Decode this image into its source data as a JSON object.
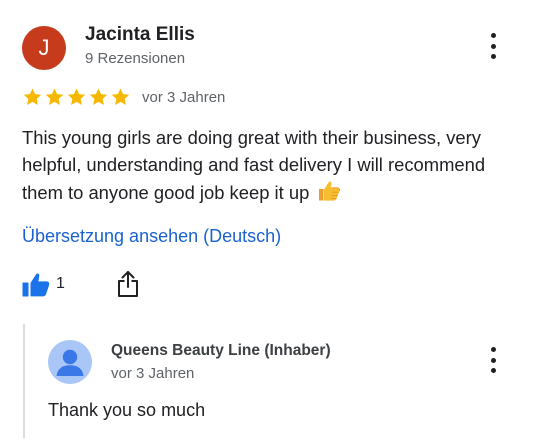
{
  "review": {
    "avatar_initial": "J",
    "avatar_color": "#c53b1c",
    "reviewer_name": "Jacinta Ellis",
    "reviewer_meta": "9 Rezensionen",
    "rating": 5,
    "rating_max": 5,
    "star_color": "#f6b800",
    "date": "vor 3 Jahren",
    "text": "This young girls are doing great with their business, very helpful, understanding and fast delivery I will recommend them to anyone good job keep it up",
    "emoji_icon": "thumbs-up-emoji-icon",
    "translate_link": "Übersetzung ansehen (Deutsch)",
    "like_count": "1",
    "like_icon": "thumbs-up-icon",
    "share_icon": "share-icon",
    "more_icon": "more-vert-icon"
  },
  "reply": {
    "owner_name": "Queens Beauty Line (Inhaber)",
    "date": "vor 3 Jahren",
    "text": "Thank you so much",
    "avatar_icon": "person-icon",
    "avatar_color": "#a9c6f7",
    "more_icon": "more-vert-icon"
  },
  "colors": {
    "link": "#1a62d0",
    "like_blue": "#1a73e8",
    "secondary_text": "#5f6368"
  }
}
